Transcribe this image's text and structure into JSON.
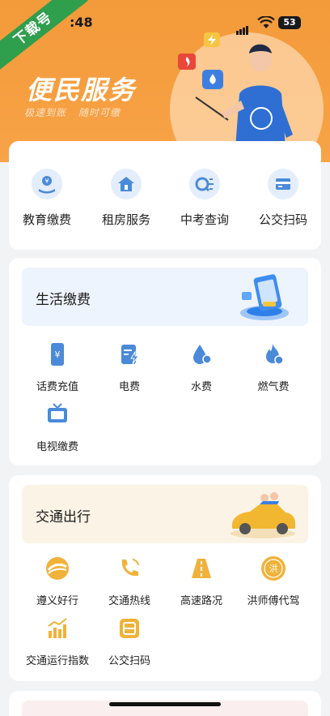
{
  "status": {
    "time": ":48",
    "battery": "53"
  },
  "watermark": "下载号",
  "banner": {
    "title": "便民服务",
    "subtitle_left": "极速到账",
    "subtitle_right": "随时可缴"
  },
  "quick": [
    {
      "label": "教育缴费",
      "icon": "education-fee-icon"
    },
    {
      "label": "租房服务",
      "icon": "house-rent-icon"
    },
    {
      "label": "中考查询",
      "icon": "exam-query-icon"
    },
    {
      "label": "公交扫码",
      "icon": "bus-card-icon"
    }
  ],
  "life": {
    "title": "生活缴费",
    "items": [
      {
        "label": "话费充值",
        "icon": "phone-recharge-icon"
      },
      {
        "label": "电费",
        "icon": "electricity-icon"
      },
      {
        "label": "水费",
        "icon": "water-icon"
      },
      {
        "label": "燃气费",
        "icon": "gas-icon"
      },
      {
        "label": "电视缴费",
        "icon": "tv-icon"
      }
    ]
  },
  "traffic": {
    "title": "交通出行",
    "items": [
      {
        "label": "遵义好行",
        "icon": "zunyi-travel-icon"
      },
      {
        "label": "交通热线",
        "icon": "hotline-icon"
      },
      {
        "label": "高速路况",
        "icon": "highway-icon"
      },
      {
        "label": "洪师傅代驾",
        "icon": "designated-driver-icon"
      },
      {
        "label": "交通运行指数",
        "icon": "traffic-index-icon"
      },
      {
        "label": "公交扫码",
        "icon": "bus-scan-icon"
      }
    ]
  },
  "colors": {
    "banner": "#f39a3a",
    "blue_icon": "#4a8ad8",
    "orange_icon": "#f0b23a"
  }
}
